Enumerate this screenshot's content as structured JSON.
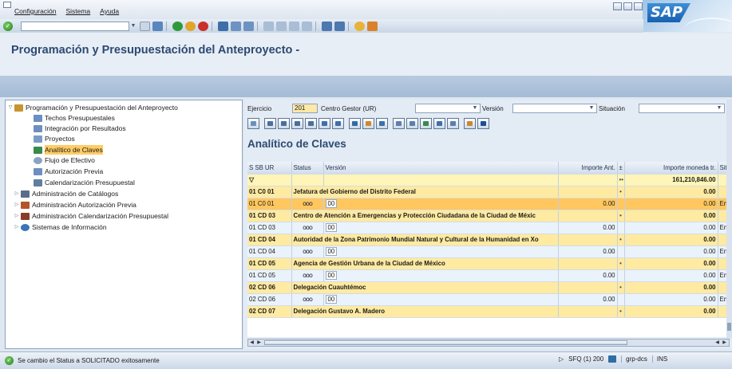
{
  "menu": [
    "Configuración",
    "Sistema",
    "Ayuda"
  ],
  "sap_logo": "SAP",
  "title": "Programación y Presupuestación del Anteproyecto -",
  "tree": {
    "root": "Programación y Presupuestación del Anteproyecto",
    "items": [
      "Techos Presupuestales",
      "Integración por Resultados",
      "Proyectos",
      "Analítico de Claves",
      "Flujo de Efectivo",
      "Autorización Previa",
      "Calendarización Presupuestal"
    ],
    "folders": [
      "Administración de Catálogos",
      "Administración Autorización Previa",
      "Administración Calendarización Presupuestal",
      "Sistemas de Información"
    ],
    "selected": "Analítico de Claves"
  },
  "filters": {
    "ejercicio_label": "Ejercicio",
    "ejercicio_value": "201",
    "centro_label": "Centro Gestor (UR)",
    "version_label": "Versión",
    "situacion_label": "Situación"
  },
  "grid_title": "Analítico de Claves",
  "grid": {
    "headers": [
      "S SB UR",
      "Status",
      "Versión",
      "Importe Ant.",
      "Importe moneda tr.",
      "Sit"
    ],
    "total": "161,210,846.00",
    "rows": [
      {
        "kind": "grp",
        "code": "01 C0 01",
        "desc": "Jefatura del Gobierno del Distrito Federal",
        "val": "0.00"
      },
      {
        "kind": "det",
        "code": "01 C0 01",
        "status": "ooo",
        "ver": "00",
        "ant": "0.00",
        "val": "0.00",
        "sit": "En",
        "hl": true
      },
      {
        "kind": "grp",
        "code": "01 CD 03",
        "desc": "Centro de Atención a Emergencias y Protección Ciudadana de la  Ciudad de Méxic",
        "val": "0.00"
      },
      {
        "kind": "det",
        "code": "01 CD 03",
        "status": "ooo",
        "ver": "00",
        "ant": "0.00",
        "val": "0.00",
        "sit": "En",
        "hl": false
      },
      {
        "kind": "grp",
        "code": "01 CD 04",
        "desc": "Autoridad de la Zona Patrimonio Mundial Natural y Cultural de la Humanidad en Xo",
        "val": "0.00"
      },
      {
        "kind": "det",
        "code": "01 CD 04",
        "status": "ooo",
        "ver": "00",
        "ant": "0.00",
        "val": "0.00",
        "sit": "En",
        "hl": false
      },
      {
        "kind": "grp",
        "code": "01 CD 05",
        "desc": "Agencia de Gestión Urbana de la Ciudad de México",
        "val": "0.00"
      },
      {
        "kind": "det",
        "code": "01 CD 05",
        "status": "ooo",
        "ver": "00",
        "ant": "0.00",
        "val": "0.00",
        "sit": "En",
        "hl": false
      },
      {
        "kind": "grp",
        "code": "02 CD 06",
        "desc": "Delegación Cuauhtémoc",
        "val": "0.00"
      },
      {
        "kind": "det",
        "code": "02 CD 06",
        "status": "ooo",
        "ver": "00",
        "ant": "0.00",
        "val": "0.00",
        "sit": "En",
        "hl": false
      },
      {
        "kind": "grp",
        "code": "02 CD 07",
        "desc": "Delegación Gustavo A. Madero",
        "val": "0.00"
      }
    ]
  },
  "status": {
    "message": "Se cambio el Status a SOLICITADO exitosamente",
    "system": "SFQ (1) 200",
    "host": "grp-dcs",
    "mode": "INS"
  },
  "colors": {
    "title": "#2c4a73",
    "selected_row": "#ffc75e",
    "group_row": "#ffeaa1"
  }
}
